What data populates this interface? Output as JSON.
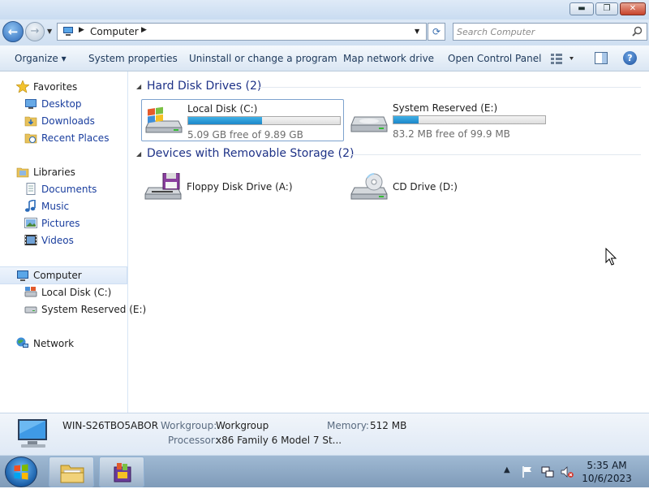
{
  "window": {
    "minimize_glyph": "▬",
    "maximize_glyph": "❐",
    "close_glyph": "✕"
  },
  "address": {
    "location": "Computer",
    "search_placeholder": "Search Computer"
  },
  "commands": {
    "organize": "Organize ▾",
    "system_properties": "System properties",
    "uninstall": "Uninstall or change a program",
    "map_drive": "Map network drive",
    "control_panel": "Open Control Panel"
  },
  "nav": {
    "favorites": "Favorites",
    "desktop": "Desktop",
    "downloads": "Downloads",
    "recent": "Recent Places",
    "libraries": "Libraries",
    "documents": "Documents",
    "music": "Music",
    "pictures": "Pictures",
    "videos": "Videos",
    "computer": "Computer",
    "local_disk": "Local Disk (C:)",
    "system_reserved": "System Reserved (E:)",
    "network": "Network"
  },
  "groups": {
    "hdd": "Hard Disk Drives (2)",
    "removable": "Devices with Removable Storage (2)"
  },
  "drives": {
    "c": {
      "name": "Local Disk (C:)",
      "free": "5.09 GB free of 9.89 GB",
      "used_fraction": 0.485
    },
    "e": {
      "name": "System Reserved (E:)",
      "free": "83.2 MB free of 99.9 MB",
      "used_fraction": 0.167
    },
    "a": {
      "name": "Floppy Disk Drive (A:)"
    },
    "d": {
      "name": "CD Drive (D:)"
    }
  },
  "details": {
    "computer_name": "WIN-S26TBO5ABOR",
    "workgroup_label": "Workgroup:",
    "workgroup_value": "Workgroup",
    "memory_label": "Memory:",
    "memory_value": "512 MB",
    "processor_label": "Processor:",
    "processor_value": "x86 Family 6 Model 7 St..."
  },
  "taskbar": {
    "time": "5:35 AM",
    "date": "10/6/2023"
  },
  "colors": {
    "drive_bar_fill": "#26a0da",
    "link_text": "#1a3e9e",
    "group_header": "#1e3287"
  }
}
